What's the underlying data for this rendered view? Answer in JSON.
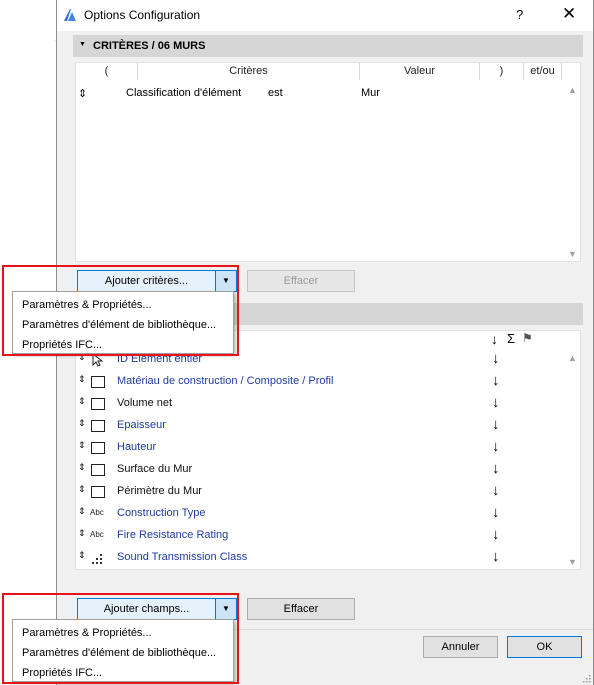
{
  "window": {
    "title": "Options Configuration",
    "help": "?",
    "close": "✕"
  },
  "criteria": {
    "header": "CRITÈRES / 06 MURS",
    "columns": [
      "(",
      "Critères",
      "Valeur",
      ")",
      "et/ou"
    ],
    "rows": [
      {
        "updown": "⇕",
        "criterion": "Classification d'élément",
        "operator": "est",
        "value": "Mur"
      }
    ],
    "add_button": "Ajouter critères...",
    "clear_button": "Effacer"
  },
  "criteria_menu": {
    "items": [
      "Paramètres & Propriétés...",
      "Paramètres d'élément de bibliothèque...",
      "Propriétés IFC..."
    ]
  },
  "fields": {
    "column_icons": [
      "↓",
      "Σ",
      "⚑"
    ],
    "rows": [
      {
        "label": "ID Elément entier",
        "icon": "cursor-icon",
        "style": "blue",
        "arrow": "↓"
      },
      {
        "label": "Matériau de construction / Composite / Profil",
        "icon": "rectangle-icon",
        "style": "blue",
        "arrow": "↓"
      },
      {
        "label": "Volume net",
        "icon": "rectangle-icon",
        "style": "black",
        "arrow": "↓"
      },
      {
        "label": "Epaisseur",
        "icon": "rectangle-icon",
        "style": "blue",
        "arrow": "↓"
      },
      {
        "label": "Hauteur",
        "icon": "rectangle-icon",
        "style": "blue",
        "arrow": "↓"
      },
      {
        "label": "Surface du Mur",
        "icon": "rectangle-icon",
        "style": "black",
        "arrow": "↓"
      },
      {
        "label": "Périmètre du Mur",
        "icon": "rectangle-icon",
        "style": "black",
        "arrow": "↓"
      },
      {
        "label": "Construction Type",
        "icon": "abc-icon",
        "abc": "Abc",
        "style": "blue",
        "arrow": "↓"
      },
      {
        "label": "Fire Resistance Rating",
        "icon": "abc-icon",
        "abc": "Abc",
        "style": "blue",
        "arrow": "↓"
      },
      {
        "label": "Sound Transmission Class",
        "icon": "dots-icon",
        "style": "blue",
        "arrow": "↓"
      }
    ],
    "add_button": "Ajouter champs...",
    "clear_button": "Effacer"
  },
  "fields_menu": {
    "items": [
      "Paramètres & Propriétés...",
      "Paramètres d'élément de bibliothèque...",
      "Propriétés IFC..."
    ]
  },
  "footer": {
    "cancel": "Annuler",
    "ok": "OK"
  },
  "colors": {
    "highlight_red": "#e8141b",
    "link_blue": "#1f3c9e",
    "split_border": "#0078d7"
  }
}
